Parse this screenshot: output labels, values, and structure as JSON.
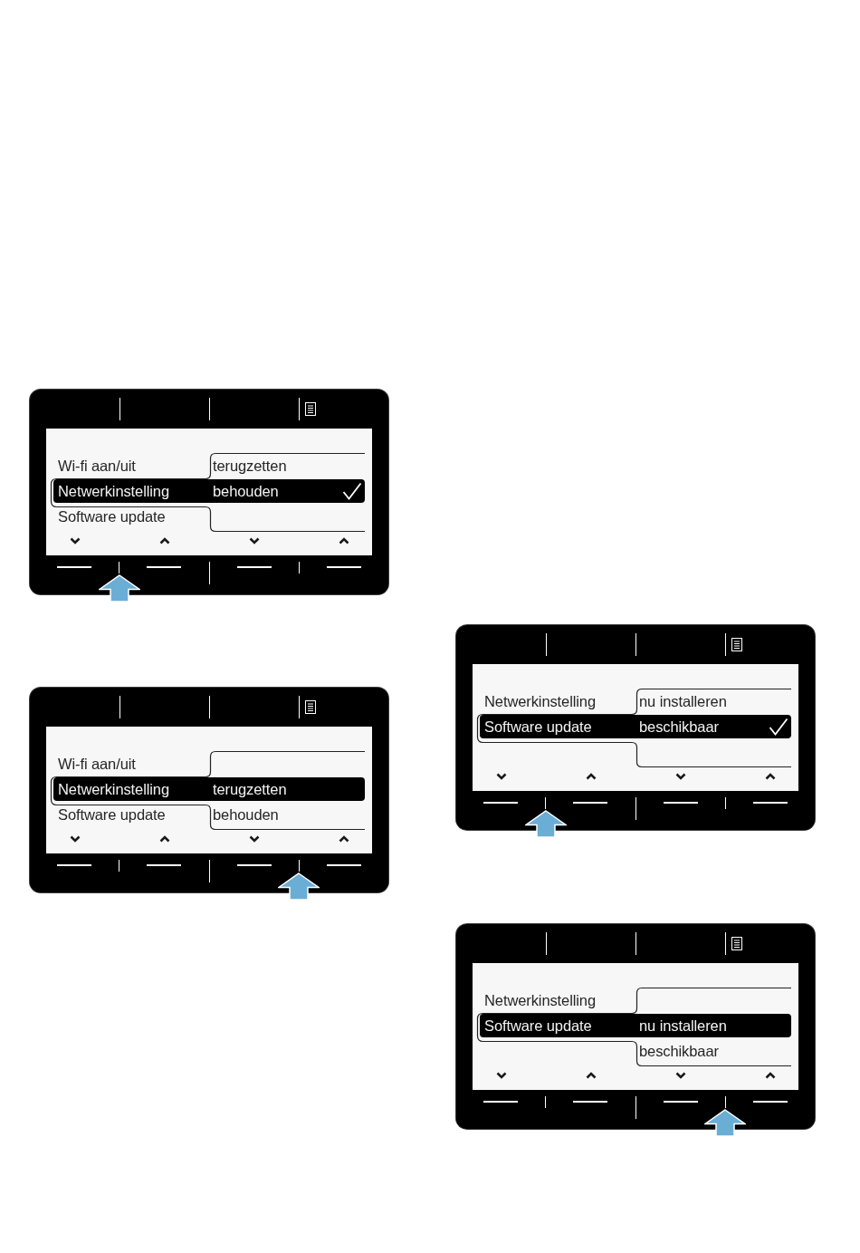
{
  "columns": [
    {
      "panels": [
        {
          "rows": [
            {
              "label": "Wi-fi aan/uit",
              "selected": false
            },
            {
              "label": "Netwerkinstelling",
              "selected": true
            },
            {
              "label": "Software update",
              "selected": false
            }
          ],
          "options": [
            {
              "text": "terugzetten",
              "selected": false,
              "checked": false
            },
            {
              "text": "behouden",
              "selected": true,
              "checked": true
            }
          ],
          "key_pairs": [
            {
              "pointed": true
            },
            {
              "pointed": false
            }
          ]
        },
        {
          "rows": [
            {
              "label": "Wi-fi aan/uit",
              "selected": false
            },
            {
              "label": "Netwerkinstelling",
              "selected": true
            },
            {
              "label": "Software update",
              "selected": false
            }
          ],
          "options": [
            {
              "text": "terugzetten",
              "selected": true,
              "checked": false
            },
            {
              "text": "behouden",
              "selected": false,
              "checked": false
            }
          ],
          "key_pairs": [
            {
              "pointed": false
            },
            {
              "pointed": true
            }
          ]
        }
      ]
    },
    {
      "panels": [
        {
          "rows": [
            {
              "label": "Netwerkinstelling",
              "selected": false
            },
            {
              "label": "Software update",
              "selected": true
            }
          ],
          "options": [
            {
              "text": "nu installeren",
              "selected": false,
              "checked": false
            },
            {
              "text": "beschikbaar",
              "selected": true,
              "checked": true
            }
          ],
          "key_pairs": [
            {
              "pointed": true
            },
            {
              "pointed": false
            }
          ]
        },
        {
          "rows": [
            {
              "label": "Netwerkinstelling",
              "selected": false
            },
            {
              "label": "Software update",
              "selected": true
            }
          ],
          "options": [
            {
              "text": "nu installeren",
              "selected": true,
              "checked": false
            },
            {
              "text": "beschikbaar",
              "selected": false,
              "checked": false
            }
          ],
          "key_pairs": [
            {
              "pointed": false
            },
            {
              "pointed": true
            }
          ]
        }
      ]
    }
  ]
}
